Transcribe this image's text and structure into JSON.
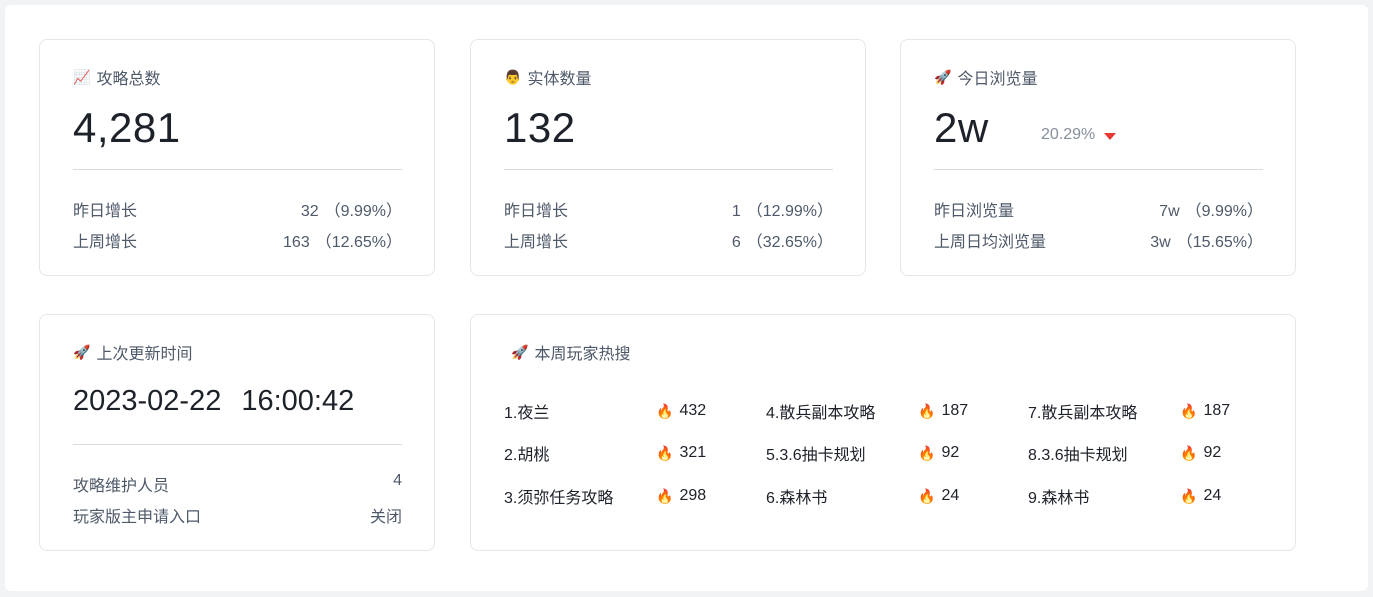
{
  "cards": {
    "guides": {
      "icon": "chart-increasing-icon",
      "title": "攻略总数",
      "value": "4,281",
      "rows": [
        {
          "label": "昨日增长",
          "num": "32",
          "pct": "（9.99%）"
        },
        {
          "label": "上周增长",
          "num": "163",
          "pct": "（12.65%）"
        }
      ]
    },
    "entities": {
      "icon": "person-icon",
      "title": "实体数量",
      "value": "132",
      "rows": [
        {
          "label": "昨日增长",
          "num": "1",
          "pct": "（12.99%）"
        },
        {
          "label": "上周增长",
          "num": "6",
          "pct": "（32.65%）"
        }
      ]
    },
    "views": {
      "icon": "rocket-icon",
      "title": "今日浏览量",
      "value": "2w",
      "trend": "20.29%",
      "trend_direction": "down",
      "trend_color": "#e53935",
      "rows": [
        {
          "label": "昨日浏览量",
          "num": "7w",
          "pct": "（9.99%）"
        },
        {
          "label": "上周日均浏览量",
          "num": "3w",
          "pct": "（15.65%）"
        }
      ]
    },
    "last_update": {
      "icon": "rocket-icon",
      "title": "上次更新时间",
      "date": "2023-02-22",
      "time": "16:00:42",
      "rows": [
        {
          "label": "攻略维护人员",
          "value": "4"
        },
        {
          "label": "玩家版主申请入口",
          "value": "关闭"
        }
      ]
    },
    "hot_search": {
      "icon": "rocket-icon",
      "title": "本周玩家热搜",
      "heat_icon": "fire-icon",
      "items": [
        {
          "name": "1.夜兰",
          "heat": "432"
        },
        {
          "name": "2.胡桃",
          "heat": "321"
        },
        {
          "name": "3.须弥任务攻略",
          "heat": "298"
        },
        {
          "name": "4.散兵副本攻略",
          "heat": "187"
        },
        {
          "name": "5.3.6抽卡规划",
          "heat": "92"
        },
        {
          "name": "6.森林书",
          "heat": "24"
        },
        {
          "name": "7.散兵副本攻略",
          "heat": "187"
        },
        {
          "name": "8.3.6抽卡规划",
          "heat": "92"
        },
        {
          "name": "9.森林书",
          "heat": "24"
        }
      ]
    }
  }
}
